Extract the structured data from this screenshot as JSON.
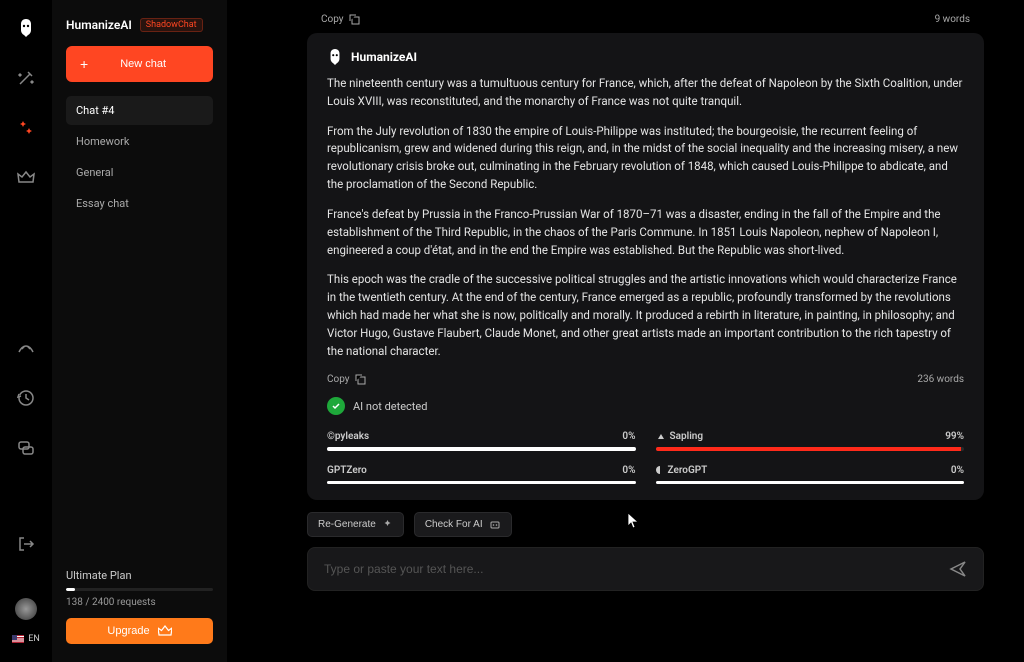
{
  "app": {
    "name": "HumanizeAI",
    "badge": "ShadowChat"
  },
  "sidebar": {
    "new_chat": "New chat",
    "chats": [
      {
        "label": "Chat #4",
        "active": true
      },
      {
        "label": "Homework",
        "active": false
      },
      {
        "label": "General",
        "active": false
      },
      {
        "label": "Essay chat",
        "active": false
      }
    ],
    "plan": {
      "name": "Ultimate Plan",
      "requests": "138 / 2400 requests",
      "upgrade": "Upgrade",
      "fill_pct": 6
    }
  },
  "lang": "EN",
  "top": {
    "copy": "Copy",
    "words": "9 words"
  },
  "response": {
    "title": "HumanizeAI",
    "paragraphs": [
      "The nineteenth century was a tumultuous century for France, which, after the defeat of Napoleon by the Sixth Coalition, under Louis XVIII, was reconstituted, and the monarchy of France was not quite tranquil.",
      "From the July revolution of 1830 the empire of Louis-Philippe was instituted; the bourgeoisie, the recurrent feeling of republicanism, grew and widened during this reign, and, in the midst of the social inequality and the increasing misery, a new revolutionary crisis broke out, culminating in the February revolution of 1848, which caused Louis-Philippe to abdicate, and the proclamation of the Second Republic.",
      "France's defeat by Prussia in the Franco-Prussian War of 1870–71 was a disaster, ending in the fall of the Empire and the establishment of the Third Republic, in the chaos of the Paris Commune. In 1851 Louis Napoleon, nephew of Napoleon I, engineered a coup d'état, and in the end the Empire was established. But the Republic was short-lived.",
      "This epoch was the cradle of the successive political struggles and the artistic innovations which would characterize France in the twentieth century. At the end of the century, France emerged as a republic, profoundly transformed by the revolutions which had made her what she is now, politically and morally. It produced a rebirth in literature, in painting, in philosophy; and Victor Hugo, Gustave Flaubert, Claude Monet, and other great artists made an important contribution to the rich tapestry of the national character."
    ],
    "footer": {
      "copy": "Copy",
      "words": "236 words"
    },
    "ai_status": "AI not detected",
    "detectors": [
      {
        "name": "©pyleaks",
        "pct": "0%",
        "fill": 100,
        "color": "white"
      },
      {
        "name": "Sapling",
        "pct": "99%",
        "fill": 99,
        "color": "red"
      },
      {
        "name": "GPTZero",
        "pct": "0%",
        "fill": 100,
        "color": "white"
      },
      {
        "name": "ZeroGPT",
        "pct": "0%",
        "fill": 100,
        "color": "white"
      }
    ]
  },
  "actions": {
    "regenerate": "Re-Generate",
    "check": "Check For AI"
  },
  "input": {
    "placeholder": "Type or paste your text here..."
  }
}
